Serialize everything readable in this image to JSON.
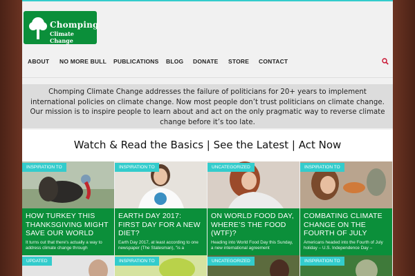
{
  "brand": {
    "line1": "Chomping",
    "line2": "Climate Change",
    "color": "#0b8f3a"
  },
  "nav": {
    "items": [
      "ABOUT",
      "NO MORE BULL",
      "PUBLICATIONS",
      "BLOG",
      "DONATE",
      "STORE",
      "CONTACT"
    ],
    "search_icon": "search-icon"
  },
  "mission": "Chomping Climate Change addresses the failure of politicians for 20+ years to implement international policies on climate change. Now most people don’t trust politicians on climate change. Our mission is to inspire people to learn about and act on the only pragmatic way to reverse climate change before it’s too late.",
  "cta": "Watch & Read the Basics | See the Latest | Act Now",
  "cards": [
    {
      "tag": "Inspiration to",
      "title": "How Turkey This Thanksgiving Might Save Our World",
      "excerpt": "It turns out that there's actually a way to address climate change through"
    },
    {
      "tag": "Inspiration to",
      "title": "Earth Day 2017: First Day for a New Diet?",
      "excerpt": "Earth Day 2017, at least according to one newspaper (The Statesman), \"is a"
    },
    {
      "tag": "Uncategorized",
      "title": "On World Food Day, Where’s the Food (WTF)?",
      "excerpt": "Heading into World Food Day this Sunday, a new international agreement"
    },
    {
      "tag": "Inspiration to",
      "title": "Combating Climate Change on the Fourth of July",
      "excerpt": "Americans headed into the Fourth of July holiday – U.S. Independence Day –"
    }
  ],
  "cards_row2": [
    {
      "tag": "Updated"
    },
    {
      "tag": "Inspiration to"
    },
    {
      "tag": "Uncategorized"
    },
    {
      "tag": "Inspiration to"
    }
  ],
  "colors": {
    "accent_teal": "#33cccc",
    "green": "#0b8f3a",
    "frame": "#5a2a1e"
  }
}
